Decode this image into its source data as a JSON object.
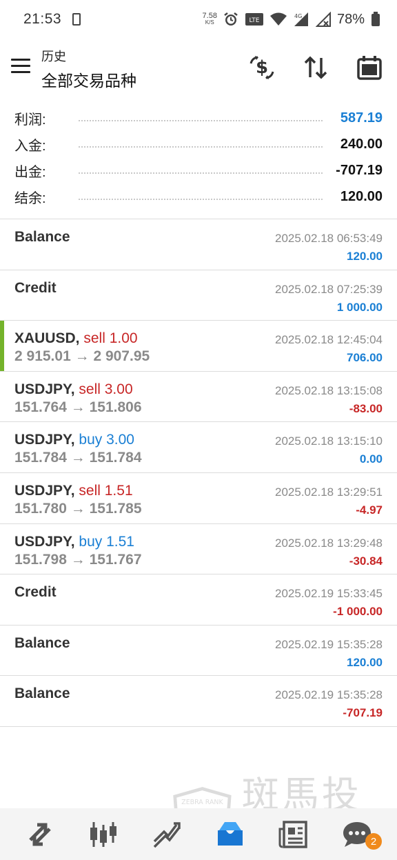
{
  "status_bar": {
    "time": "21:53",
    "net_speed_value": "7.58",
    "net_speed_unit": "K/S",
    "battery_percent": "78%"
  },
  "header": {
    "title_small": "历史",
    "title_main": "全部交易品种"
  },
  "summary": [
    {
      "label": "利润:",
      "value": "587.19",
      "color": "#1a7fd4"
    },
    {
      "label": "入金:",
      "value": "240.00",
      "color": "#111111"
    },
    {
      "label": "出金:",
      "value": "-707.19",
      "color": "#111111"
    },
    {
      "label": "结余:",
      "value": "120.00",
      "color": "#111111"
    }
  ],
  "deals": [
    {
      "symbol": "Balance",
      "side": "",
      "volume": "",
      "open_price": "",
      "close_price": "",
      "time": "2025.02.18 06:53:49",
      "amount": "120.00",
      "amount_color": "blue",
      "highlighted": false
    },
    {
      "symbol": "Credit",
      "side": "",
      "volume": "",
      "open_price": "",
      "close_price": "",
      "time": "2025.02.18 07:25:39",
      "amount": "1 000.00",
      "amount_color": "blue",
      "highlighted": false
    },
    {
      "symbol": "XAUUSD,",
      "side": "sell",
      "volume": "1.00",
      "open_price": "2 915.01",
      "close_price": "2 907.95",
      "time": "2025.02.18 12:45:04",
      "amount": "706.00",
      "amount_color": "blue",
      "highlighted": true
    },
    {
      "symbol": "USDJPY,",
      "side": "sell",
      "volume": "3.00",
      "open_price": "151.764",
      "close_price": "151.806",
      "time": "2025.02.18 13:15:08",
      "amount": "-83.00",
      "amount_color": "red",
      "highlighted": false
    },
    {
      "symbol": "USDJPY,",
      "side": "buy",
      "volume": "3.00",
      "open_price": "151.784",
      "close_price": "151.784",
      "time": "2025.02.18 13:15:10",
      "amount": "0.00",
      "amount_color": "blue",
      "highlighted": false
    },
    {
      "symbol": "USDJPY,",
      "side": "sell",
      "volume": "1.51",
      "open_price": "151.780",
      "close_price": "151.785",
      "time": "2025.02.18 13:29:51",
      "amount": "-4.97",
      "amount_color": "red",
      "highlighted": false
    },
    {
      "symbol": "USDJPY,",
      "side": "buy",
      "volume": "1.51",
      "open_price": "151.798",
      "close_price": "151.767",
      "time": "2025.02.18 13:29:48",
      "amount": "-30.84",
      "amount_color": "red",
      "highlighted": false
    },
    {
      "symbol": "Credit",
      "side": "",
      "volume": "",
      "open_price": "",
      "close_price": "",
      "time": "2025.02.19 15:33:45",
      "amount": "-1 000.00",
      "amount_color": "red",
      "highlighted": false
    },
    {
      "symbol": "Balance",
      "side": "",
      "volume": "",
      "open_price": "",
      "close_price": "",
      "time": "2025.02.19 15:35:28",
      "amount": "120.00",
      "amount_color": "blue",
      "highlighted": false
    },
    {
      "symbol": "Balance",
      "side": "",
      "volume": "",
      "open_price": "",
      "close_price": "",
      "time": "2025.02.19 15:35:28",
      "amount": "-707.19",
      "amount_color": "red",
      "highlighted": false
    }
  ],
  "bottom_nav": [
    {
      "name": "quotes-tab",
      "icon": "arrows-updown-icon"
    },
    {
      "name": "chart-tab",
      "icon": "candlestick-icon"
    },
    {
      "name": "trade-tab",
      "icon": "trend-line-icon"
    },
    {
      "name": "history-tab",
      "icon": "inbox-icon",
      "active": true
    },
    {
      "name": "news-tab",
      "icon": "newspaper-icon"
    },
    {
      "name": "messages-tab",
      "icon": "chat-icon",
      "badge": "2"
    }
  ],
  "watermark": {
    "text": "斑馬投訴",
    "shield_text": "ZEBRA RANK"
  },
  "colors": {
    "accent_blue": "#1a7fd4",
    "loss_red": "#c72626",
    "highlight_green": "#74b32b",
    "active_tab": "#2196f3"
  }
}
